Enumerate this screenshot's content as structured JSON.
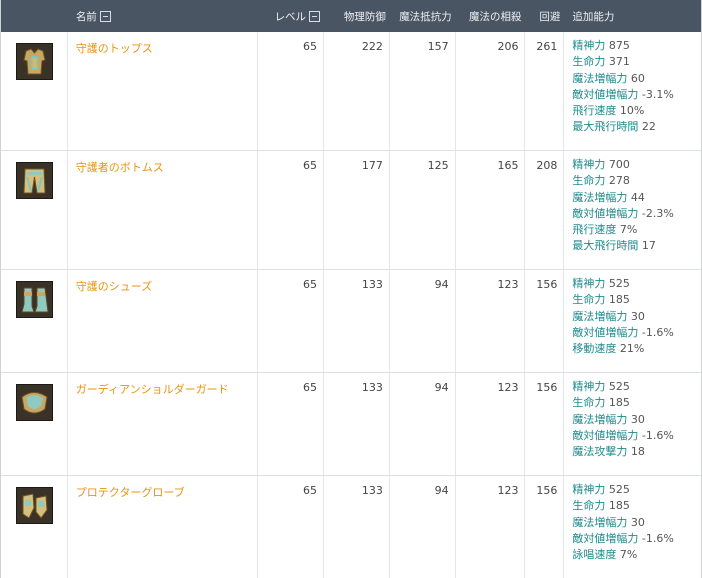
{
  "header": {
    "name": "名前",
    "level": "レベル",
    "pdef": "物理防御",
    "mres": "魔法抵抗力",
    "mcancel": "魔法の相殺",
    "evasion": "回避",
    "extra": "追加能力"
  },
  "items": [
    {
      "icon": "armor-top-icon",
      "name": "守護のトップス",
      "level": "65",
      "pdef": "222",
      "mres": "157",
      "mcancel": "206",
      "evasion": "261",
      "stats": [
        {
          "label": "精神力",
          "value": "875"
        },
        {
          "label": "生命力",
          "value": "371"
        },
        {
          "label": "魔法増幅力",
          "value": "60"
        },
        {
          "label": "敵対値増幅力",
          "value": "-3.1%"
        },
        {
          "label": "飛行速度",
          "value": "10%"
        },
        {
          "label": "最大飛行時間",
          "value": "22"
        }
      ]
    },
    {
      "icon": "armor-bottom-icon",
      "name": "守護者のボトムス",
      "level": "65",
      "pdef": "177",
      "mres": "125",
      "mcancel": "165",
      "evasion": "208",
      "stats": [
        {
          "label": "精神力",
          "value": "700"
        },
        {
          "label": "生命力",
          "value": "278"
        },
        {
          "label": "魔法増幅力",
          "value": "44"
        },
        {
          "label": "敵対値増幅力",
          "value": "-2.3%"
        },
        {
          "label": "飛行速度",
          "value": "7%"
        },
        {
          "label": "最大飛行時間",
          "value": "17"
        }
      ]
    },
    {
      "icon": "armor-shoes-icon",
      "name": "守護のシューズ",
      "level": "65",
      "pdef": "133",
      "mres": "94",
      "mcancel": "123",
      "evasion": "156",
      "stats": [
        {
          "label": "精神力",
          "value": "525"
        },
        {
          "label": "生命力",
          "value": "185"
        },
        {
          "label": "魔法増幅力",
          "value": "30"
        },
        {
          "label": "敵対値増幅力",
          "value": "-1.6%"
        },
        {
          "label": "移動速度",
          "value": "21%"
        }
      ]
    },
    {
      "icon": "armor-shoulder-icon",
      "name": "ガーディアンショルダーガード",
      "level": "65",
      "pdef": "133",
      "mres": "94",
      "mcancel": "123",
      "evasion": "156",
      "stats": [
        {
          "label": "精神力",
          "value": "525"
        },
        {
          "label": "生命力",
          "value": "185"
        },
        {
          "label": "魔法増幅力",
          "value": "30"
        },
        {
          "label": "敵対値増幅力",
          "value": "-1.6%"
        },
        {
          "label": "魔法攻撃力",
          "value": "18"
        }
      ]
    },
    {
      "icon": "armor-glove-icon",
      "name": "プロテクターグローブ",
      "level": "65",
      "pdef": "133",
      "mres": "94",
      "mcancel": "123",
      "evasion": "156",
      "stats": [
        {
          "label": "精神力",
          "value": "525"
        },
        {
          "label": "生命力",
          "value": "185"
        },
        {
          "label": "魔法増幅力",
          "value": "30"
        },
        {
          "label": "敵対値増幅力",
          "value": "-1.6%"
        },
        {
          "label": "詠唱速度",
          "value": "7%"
        }
      ]
    }
  ]
}
